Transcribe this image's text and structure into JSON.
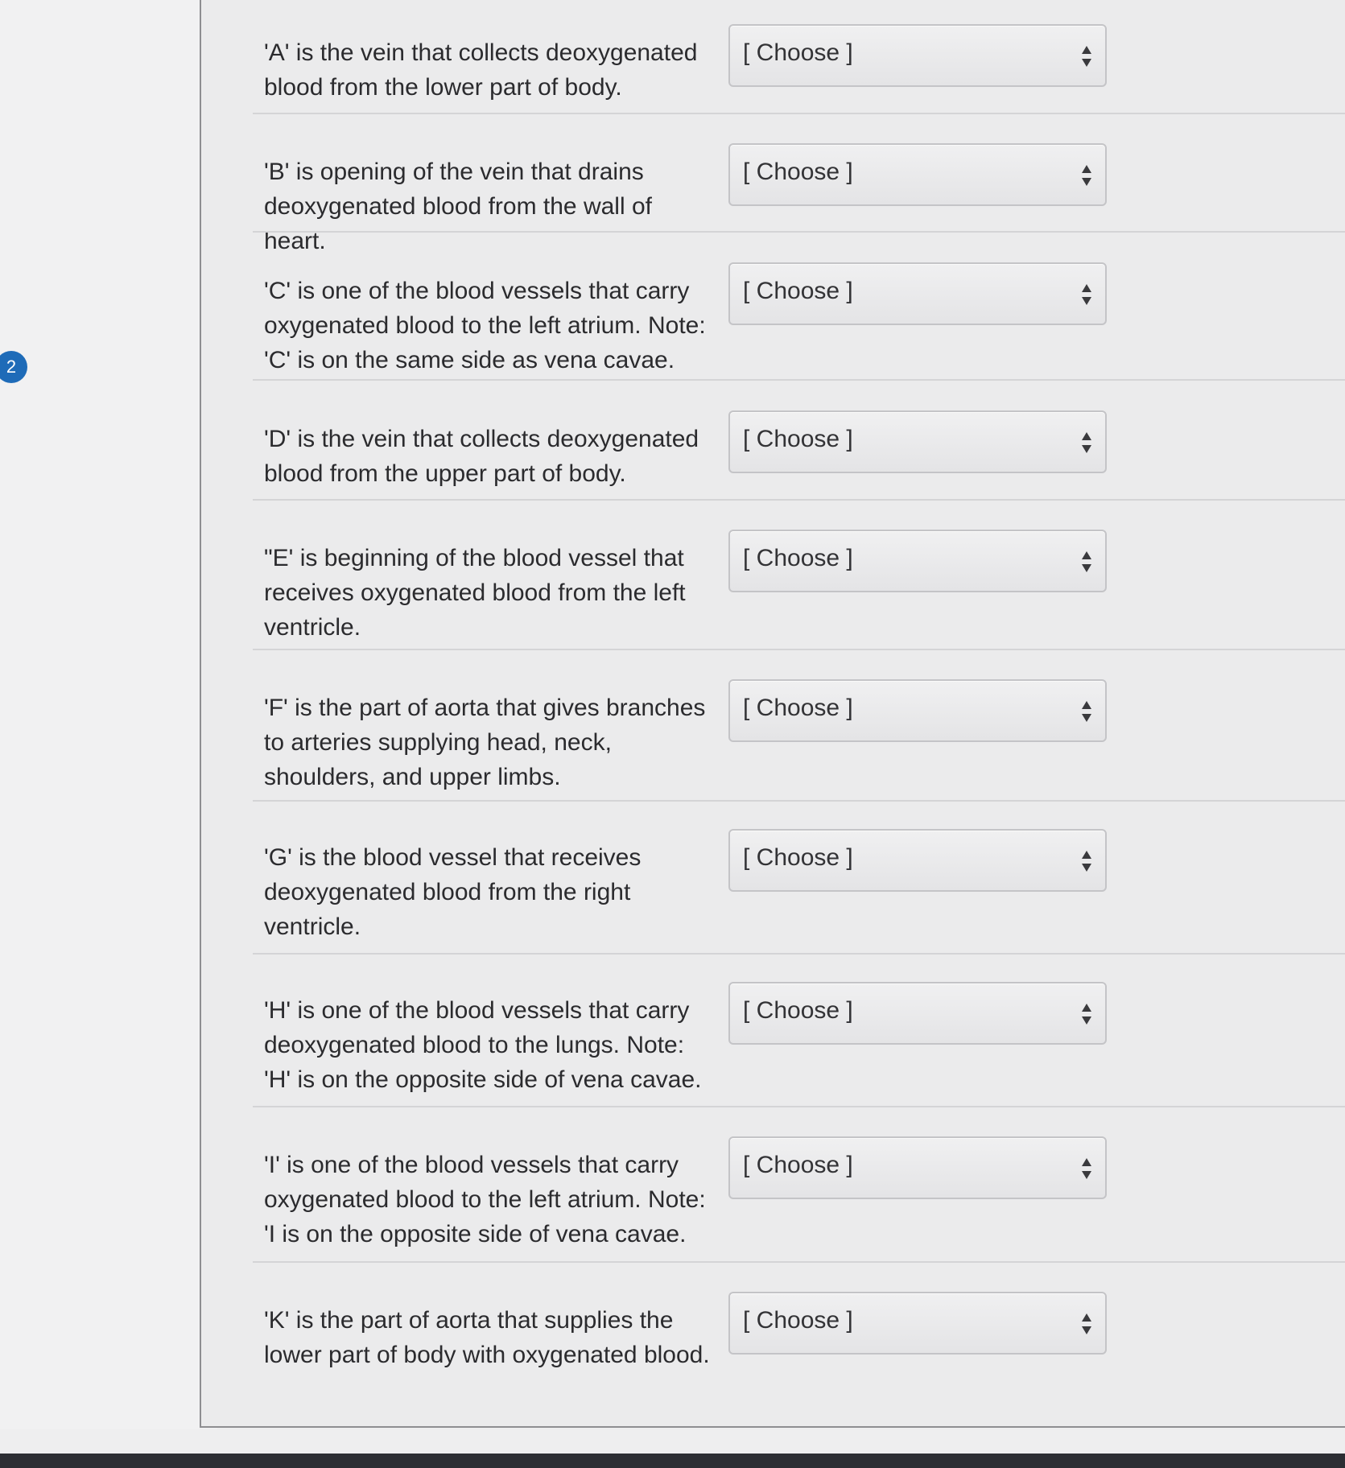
{
  "question": {
    "number": "2"
  },
  "select_placeholder": "[ Choose ]",
  "rows": [
    {
      "text": "'A' is the vein that collects deoxygenated blood from the lower part of body.",
      "selected": "[ Choose ]"
    },
    {
      "text": "'B' is opening of the vein that drains deoxygenated blood from the wall of heart.",
      "selected": "[ Choose ]"
    },
    {
      "text": "'C' is one of the blood vessels that carry oxygenated blood to the left atrium. Note: 'C' is on the same side as vena cavae.",
      "selected": "[ Choose ]"
    },
    {
      "text": "'D' is the vein that collects deoxygenated blood from the upper part of body.",
      "selected": "[ Choose ]"
    },
    {
      "text": "\"E' is beginning of the blood vessel that receives oxygenated blood from the left ventricle.",
      "selected": "[ Choose ]"
    },
    {
      "text": "'F' is the part of aorta that gives branches to arteries supplying head, neck, shoulders, and upper limbs.",
      "selected": "[ Choose ]"
    },
    {
      "text": "'G' is the blood vessel that receives deoxygenated blood from the right ventricle.",
      "selected": "[ Choose ]"
    },
    {
      "text": "'H' is one of the blood vessels that carry deoxygenated blood to the lungs. Note: 'H' is on the opposite side of vena cavae.",
      "selected": "[ Choose ]"
    },
    {
      "text": "'I' is one of the blood vessels that carry oxygenated blood to the left atrium. Note: 'I is on the opposite side of vena cavae.",
      "selected": "[ Choose ]"
    },
    {
      "text": "'K' is the part of aorta that supplies the lower part of body with oxygenated blood.",
      "selected": "[ Choose ]"
    }
  ],
  "icons": {
    "select_arrow": "updown-chevron-icon"
  }
}
